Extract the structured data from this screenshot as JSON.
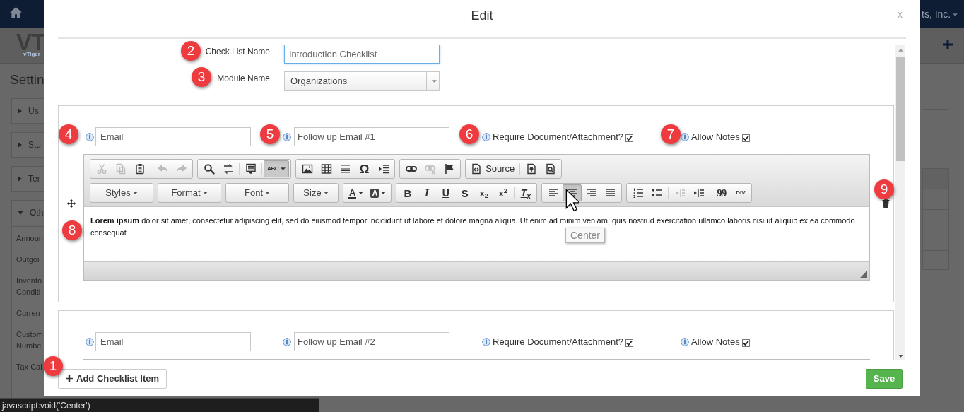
{
  "background": {
    "logo": "VT",
    "logo_tagline": "vTiger",
    "page_title": "Settin",
    "account": "ts, Inc.",
    "sections": [
      {
        "label": "Us",
        "expanded": false
      },
      {
        "label": "Stu",
        "expanded": false
      },
      {
        "label": "Ter",
        "expanded": false
      },
      {
        "label": "Oth",
        "expanded": true
      }
    ],
    "links": [
      "Announ",
      "Outgoi",
      "Invento Conditi",
      "Curren",
      "Custom Numbe",
      "Tax Cal"
    ]
  },
  "dialog": {
    "title": "Edit",
    "close": "x",
    "fields": [
      {
        "label": "Check List Name",
        "value": "Introduction Checklist",
        "kind": "text",
        "focused": true
      },
      {
        "label": "Module Name",
        "value": "Organizations",
        "kind": "select",
        "focused": false
      }
    ],
    "items": [
      {
        "type_value": "Email",
        "title_value": "Follow up Email #1",
        "options": [
          {
            "label": "Require Document/Attachment?",
            "checked": true
          },
          {
            "label": "Allow Notes",
            "checked": true
          }
        ],
        "editor": {
          "toolbar": [
            [
              [
                {
                  "kind": "cut",
                  "disabled": true,
                  "active": false
                },
                {
                  "kind": "copy",
                  "disabled": true,
                  "active": false
                },
                {
                  "kind": "paste",
                  "disabled": false,
                  "active": false
                },
                {
                  "kind": "sep"
                },
                {
                  "kind": "undo",
                  "disabled": true,
                  "active": false
                },
                {
                  "kind": "redo",
                  "disabled": true,
                  "active": false
                }
              ],
              [
                {
                  "kind": "find",
                  "disabled": false,
                  "active": false
                },
                {
                  "kind": "replace",
                  "disabled": false,
                  "active": false
                },
                {
                  "kind": "sep"
                },
                {
                  "kind": "selectall",
                  "disabled": false,
                  "active": false
                },
                {
                  "kind": "sep"
                },
                {
                  "kind": "spell",
                  "glyph": "ABC",
                  "disabled": false,
                  "active": true
                }
              ],
              [
                {
                  "kind": "image",
                  "disabled": false,
                  "active": false
                },
                {
                  "kind": "table",
                  "disabled": false,
                  "active": false
                },
                {
                  "kind": "hr",
                  "disabled": false,
                  "active": false
                },
                {
                  "kind": "symbol",
                  "glyph": "Ω",
                  "disabled": false,
                  "active": false
                },
                {
                  "kind": "pagebreak",
                  "disabled": false,
                  "active": false
                }
              ],
              [
                {
                  "kind": "link",
                  "disabled": false,
                  "active": false
                },
                {
                  "kind": "unlink",
                  "disabled": true,
                  "active": false
                },
                {
                  "kind": "anchor",
                  "disabled": false,
                  "active": false
                }
              ],
              [
                {
                  "kind": "source",
                  "label": "Source",
                  "disabled": false,
                  "active": false
                },
                {
                  "kind": "sep"
                },
                {
                  "kind": "templates",
                  "disabled": false,
                  "active": false
                },
                {
                  "kind": "preview",
                  "disabled": false,
                  "active": false
                }
              ]
            ],
            [
              [
                {
                  "kind": "combo",
                  "label": "Styles",
                  "disabled": false,
                  "active": false
                }
              ],
              [
                {
                  "kind": "combo",
                  "label": "Format",
                  "disabled": false,
                  "active": false
                }
              ],
              [
                {
                  "kind": "combo",
                  "label": "Font",
                  "disabled": false,
                  "active": false
                }
              ],
              [
                {
                  "kind": "combo",
                  "label": "Size",
                  "disabled": false,
                  "active": false
                }
              ],
              [
                {
                  "kind": "textcolor",
                  "glyph": "A",
                  "disabled": false,
                  "active": false
                },
                {
                  "kind": "bgcolor",
                  "glyph": "A",
                  "disabled": false,
                  "active": false
                }
              ],
              [
                {
                  "kind": "bold",
                  "glyph": "B",
                  "disabled": false,
                  "active": false
                },
                {
                  "kind": "italic",
                  "glyph": "I",
                  "disabled": false,
                  "active": false
                },
                {
                  "kind": "underline",
                  "glyph": "U",
                  "disabled": false,
                  "active": false
                },
                {
                  "kind": "strike",
                  "glyph": "S",
                  "disabled": false,
                  "active": false
                },
                {
                  "kind": "script",
                  "glyph": "x$_{2}$",
                  "disabled": false,
                  "active": false
                },
                {
                  "kind": "script",
                  "glyph": "x$^{2}$",
                  "disabled": false,
                  "active": false
                },
                {
                  "kind": "sep"
                },
                {
                  "kind": "removeformat",
                  "glyph": "T$_{x}$",
                  "disabled": false,
                  "active": false
                }
              ],
              [
                {
                  "kind": "align-left",
                  "disabled": false,
                  "active": false
                },
                {
                  "kind": "align-center",
                  "disabled": false,
                  "active": true
                },
                {
                  "kind": "align-right",
                  "disabled": false,
                  "active": false
                },
                {
                  "kind": "justify",
                  "disabled": false,
                  "active": false
                }
              ],
              [
                {
                  "kind": "numbered",
                  "disabled": false,
                  "active": false
                },
                {
                  "kind": "bulleted",
                  "disabled": false,
                  "active": false
                },
                {
                  "kind": "sep"
                },
                {
                  "kind": "outdent",
                  "disabled": true,
                  "active": false
                },
                {
                  "kind": "indent",
                  "disabled": false,
                  "active": false
                },
                {
                  "kind": "sep"
                },
                {
                  "kind": "quote",
                  "glyph": "99",
                  "disabled": false,
                  "active": false
                },
                {
                  "kind": "div",
                  "glyph": "DIV",
                  "disabled": false,
                  "active": false
                }
              ]
            ]
          ],
          "content": "**Lorem ipsum** dolor sit amet, consectetur adipiscing elit, sed do eiusmod tempor incididunt ut labore et dolore magna aliqua. Ut enim ad minim veniam, quis nostrud exercitation ullamco laboris nisi ut aliquip ex ea commodo consequat"
        }
      },
      {
        "type_value": "Email",
        "title_value": "Follow up Email #2",
        "options": [
          {
            "label": "Require Document/Attachment?",
            "checked": true
          },
          {
            "label": "Allow Notes",
            "checked": true
          }
        ]
      }
    ],
    "add_button": "Add Checklist Item",
    "save_button": "Save"
  },
  "tooltip": "Center",
  "status_bar": "javascript:void('Center')",
  "callouts": [
    "1",
    "2",
    "3",
    "4",
    "5",
    "6",
    "7",
    "8",
    "9"
  ]
}
